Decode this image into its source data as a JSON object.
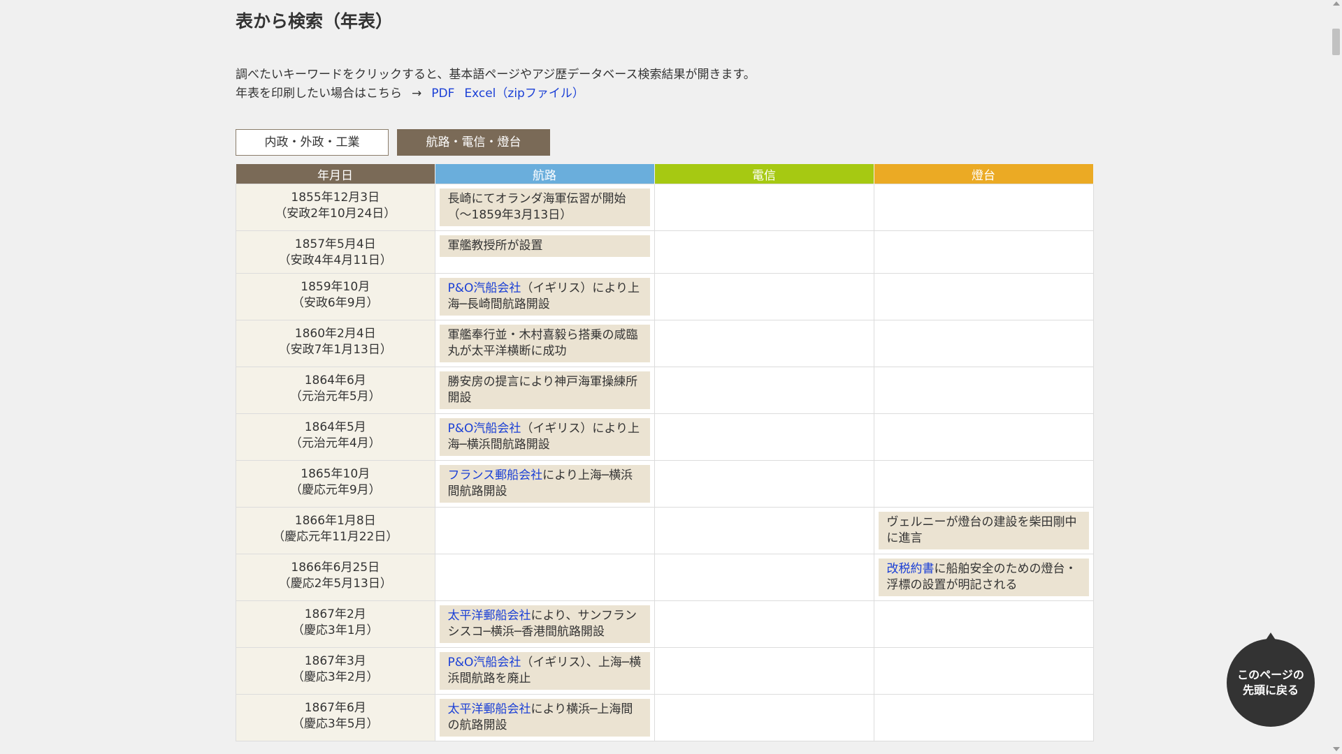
{
  "page_title": "表から検索（年表）",
  "intro": {
    "line1": "調べたいキーワードをクリックすると、基本語ページやアジ歴データベース検索結果が開きます。",
    "line2_prefix": "年表を印刷したい場合はこちら",
    "arrow": "→",
    "pdf_label": "PDF",
    "excel_label": "Excel（zipファイル）"
  },
  "tabs": [
    {
      "label": "内政・外政・工業",
      "active": false
    },
    {
      "label": "航路・電信・燈台",
      "active": true
    }
  ],
  "table": {
    "headers": {
      "date": "年月日",
      "route": "航路",
      "telegraph": "電信",
      "lighthouse": "燈台"
    },
    "rows": [
      {
        "date1": "1855年12月3日",
        "date2": "（安政2年10月24日）",
        "route_link": "",
        "route_text": "長崎にてオランダ海軍伝習が開始（～1859年3月13日）",
        "light_link": "",
        "light_text": ""
      },
      {
        "date1": "1857年5月4日",
        "date2": "（安政4年4月11日）",
        "route_link": "",
        "route_text": "軍艦教授所が設置",
        "light_link": "",
        "light_text": ""
      },
      {
        "date1": "1859年10月",
        "date2": "（安政6年9月）",
        "route_link": "P&O汽船会社",
        "route_text": "（イギリス）により上海─長崎間航路開設",
        "light_link": "",
        "light_text": ""
      },
      {
        "date1": "1860年2月4日",
        "date2": "（安政7年1月13日）",
        "route_link": "",
        "route_text": "軍艦奉行並・木村喜毅ら搭乗の咸臨丸が太平洋横断に成功",
        "light_link": "",
        "light_text": ""
      },
      {
        "date1": "1864年6月",
        "date2": "（元治元年5月）",
        "route_link": "",
        "route_text": "勝安房の提言により神戸海軍操練所開設",
        "light_link": "",
        "light_text": ""
      },
      {
        "date1": "1864年5月",
        "date2": "（元治元年4月）",
        "route_link": "P&O汽船会社",
        "route_text": "（イギリス）により上海─横浜間航路開設",
        "light_link": "",
        "light_text": ""
      },
      {
        "date1": "1865年10月",
        "date2": "（慶応元年9月）",
        "route_link": "フランス郵船会社",
        "route_text": "により上海─横浜間航路開設",
        "light_link": "",
        "light_text": ""
      },
      {
        "date1": "1866年1月8日",
        "date2": "（慶応元年11月22日）",
        "route_link": "",
        "route_text": "",
        "light_link": "",
        "light_text": "ヴェルニーが燈台の建設を柴田剛中に進言"
      },
      {
        "date1": "1866年6月25日",
        "date2": "（慶応2年5月13日）",
        "route_link": "",
        "route_text": "",
        "light_link": "改税約書",
        "light_text": "に船舶安全のための燈台・浮標の設置が明記される"
      },
      {
        "date1": "1867年2月",
        "date2": "（慶応3年1月）",
        "route_link": "太平洋郵船会社",
        "route_text": "により、サンフランシスコ─横浜─香港間航路開設",
        "light_link": "",
        "light_text": ""
      },
      {
        "date1": "1867年3月",
        "date2": "（慶応3年2月）",
        "route_link": "P&O汽船会社",
        "route_text": "（イギリス）、上海─横浜間航路を廃止",
        "light_link": "",
        "light_text": ""
      },
      {
        "date1": "1867年6月",
        "date2": "（慶応3年5月）",
        "route_link": "太平洋郵船会社",
        "route_text": "により横浜─上海間の航路開設",
        "light_link": "",
        "light_text": ""
      }
    ]
  },
  "back_to_top": {
    "line1": "このページの",
    "line2": "先頭に戻る"
  },
  "colors": {
    "date_header": "#7a6a57",
    "route_header": "#6aaedc",
    "telegraph_header": "#a6c912",
    "lighthouse_header": "#ebaa24",
    "event_bg": "#ebe3d2",
    "link": "#1a3fd6"
  }
}
